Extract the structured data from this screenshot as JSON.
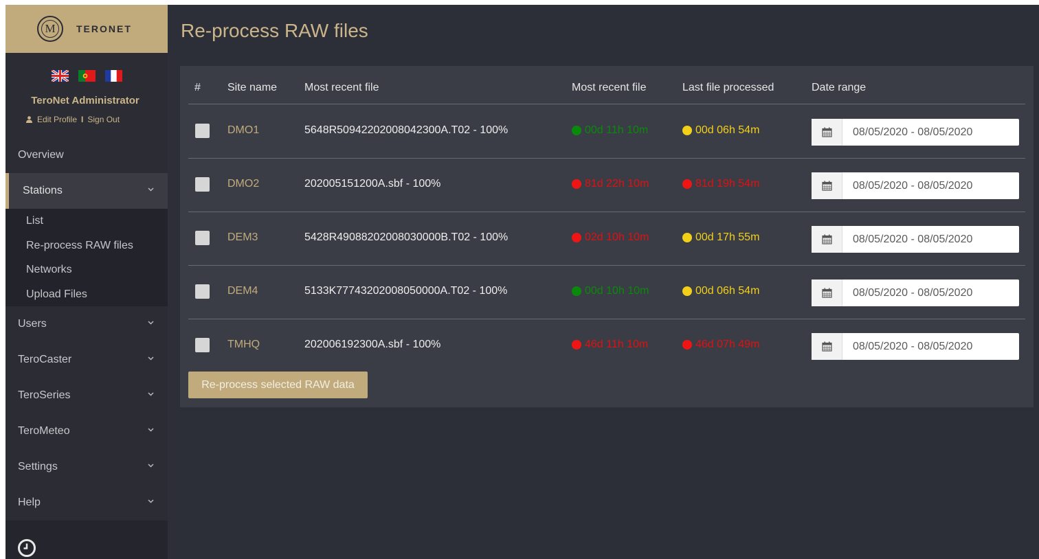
{
  "brand": {
    "name": "TERONET",
    "logo_letter": "M"
  },
  "user": {
    "name": "TeroNet Administrator",
    "edit_profile": "Edit Profile",
    "separator": "I",
    "sign_out": "Sign Out"
  },
  "languages": [
    "en",
    "pt",
    "fr"
  ],
  "sidebar": {
    "items": [
      {
        "label": "Overview"
      },
      {
        "label": "Stations",
        "expanded": true
      },
      {
        "label": "Users"
      },
      {
        "label": "TeroCaster"
      },
      {
        "label": "TeroSeries"
      },
      {
        "label": "TeroMeteo"
      },
      {
        "label": "Settings"
      },
      {
        "label": "Help"
      }
    ],
    "stations_sub": [
      "List",
      "Re-process RAW files",
      "Networks",
      "Upload Files"
    ]
  },
  "page": {
    "title": "Re-process RAW files"
  },
  "table": {
    "headers": [
      "#",
      "Site name",
      "Most recent file",
      "Most recent file",
      "Last file processed",
      "Date range"
    ],
    "rows": [
      {
        "site": "DMO1",
        "file": "5648R50942202008042300A.T02 - 100%",
        "recent_status": "green",
        "recent": "00d 11h 10m",
        "processed_status": "yellow",
        "processed": "00d 06h 54m",
        "range": "08/05/2020 - 08/05/2020"
      },
      {
        "site": "DMO2",
        "file": "202005151200A.sbf - 100%",
        "recent_status": "red",
        "recent": "81d 22h 10m",
        "processed_status": "red",
        "processed": "81d 19h 54m",
        "range": "08/05/2020 - 08/05/2020"
      },
      {
        "site": "DEM3",
        "file": "5428R49088202008030000B.T02 - 100%",
        "recent_status": "red",
        "recent": "02d 10h 10m",
        "processed_status": "yellow",
        "processed": "00d 17h 55m",
        "range": "08/05/2020 - 08/05/2020"
      },
      {
        "site": "DEM4",
        "file": "5133K77743202008050000A.T02 - 100%",
        "recent_status": "green",
        "recent": "00d 10h 10m",
        "processed_status": "yellow",
        "processed": "00d 06h 54m",
        "range": "08/05/2020 - 08/05/2020"
      },
      {
        "site": "TMHQ",
        "file": "202006192300A.sbf - 100%",
        "recent_status": "red",
        "recent": "46d 11h 10m",
        "processed_status": "red",
        "processed": "46d 07h 49m",
        "range": "08/05/2020 - 08/05/2020"
      }
    ]
  },
  "actions": {
    "reprocess": "Re-process selected RAW data"
  },
  "colors": {
    "accent": "#c1ab7c",
    "status_green": "#0a8a0a",
    "status_red": "#e01010",
    "status_yellow": "#f2d018"
  }
}
